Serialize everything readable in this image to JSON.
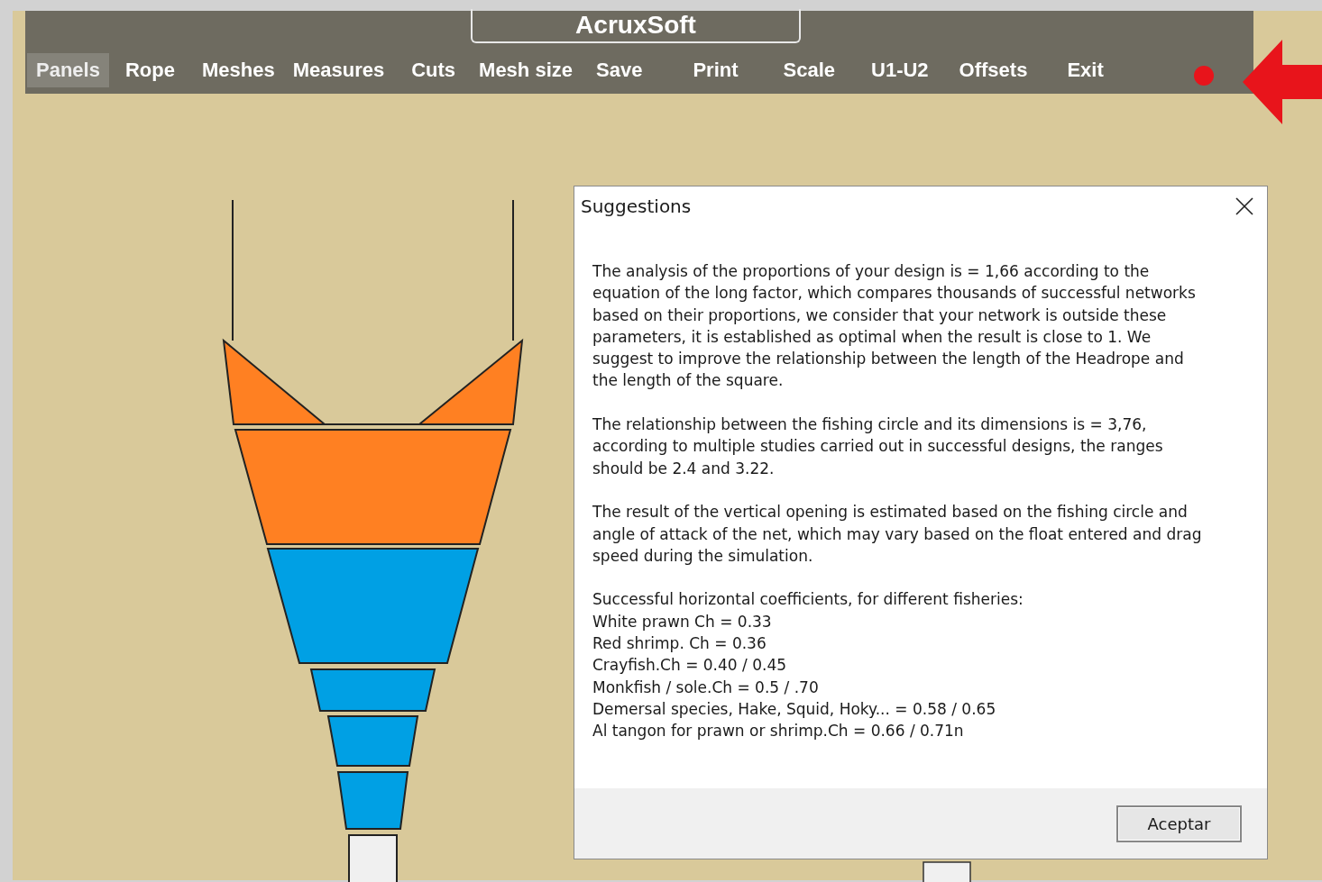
{
  "app_title": "AcruxSoft",
  "menu": [
    {
      "label": "Panels",
      "selected": true
    },
    {
      "label": "Rope",
      "selected": false
    },
    {
      "label": "Meshes",
      "selected": false
    },
    {
      "label": "Measures",
      "selected": false
    },
    {
      "label": "Cuts",
      "selected": false
    },
    {
      "label": "Mesh size",
      "selected": false
    },
    {
      "label": "Save",
      "selected": false
    },
    {
      "label": "Print",
      "selected": false
    },
    {
      "label": "Scale",
      "selected": false
    },
    {
      "label": "U1-U2",
      "selected": false
    },
    {
      "label": "Offsets",
      "selected": false
    },
    {
      "label": "Exit",
      "selected": false
    }
  ],
  "dialog": {
    "title": "Suggestions",
    "paragraphs": [
      "The analysis of the proportions of your design is = 1,66 according to the equation of the long factor, which compares thousands of successful networks based on their proportions, we consider that your network is outside these parameters, it is established as optimal when the result is close to 1. We suggest to improve the relationship between the length of the Headrope and the length of the square.",
      "The relationship between the fishing circle and its dimensions is = 3,76, according to multiple studies carried out in successful designs, the ranges should be 2.4 and 3.22.",
      "The result of the vertical opening is estimated based on the fishing circle and angle of attack of the net, which may vary based on the float entered and drag speed during the simulation."
    ],
    "list_heading": "Successful horizontal coefficients, for different fisheries:",
    "list": [
      "White prawn Ch = 0.33",
      "Red shrimp. Ch = 0.36",
      "Crayfish.Ch = 0.40 / 0.45",
      "Monkfish / sole.Ch = 0.5 / .70",
      "Demersal species, Hake, Squid, Hoky... = 0.58 / 0.65",
      "Al tangon for prawn or shrimp.Ch = 0.66 / 0.71n"
    ],
    "button": "Aceptar"
  }
}
